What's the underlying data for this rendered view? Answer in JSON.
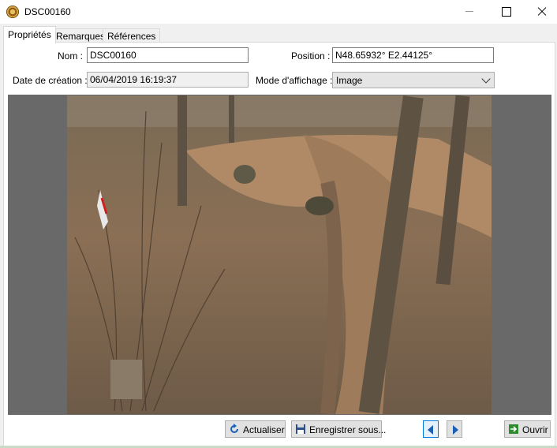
{
  "window": {
    "title": "DSC00160",
    "app_icon": "photo-app-icon"
  },
  "tabs": [
    {
      "label": "Propriétés",
      "active": true
    },
    {
      "label": "Remarques",
      "active": false
    },
    {
      "label": "Références",
      "active": false
    }
  ],
  "form": {
    "nom_label": "Nom :",
    "nom_value": "DSC00160",
    "position_label": "Position :",
    "position_value": "N48.65932° E2.44125°",
    "date_label": "Date de création :",
    "date_value": "06/04/2019 16:19:37",
    "mode_label": "Mode d'affichage :",
    "mode_value": "Image"
  },
  "buttons": {
    "actualiser": "Actualiser",
    "enregistrer": "Enregistrer sous...",
    "ouvrir": "Ouvrir"
  },
  "colors": {
    "accent": "#0078d7",
    "viewer_bg": "#696969"
  }
}
